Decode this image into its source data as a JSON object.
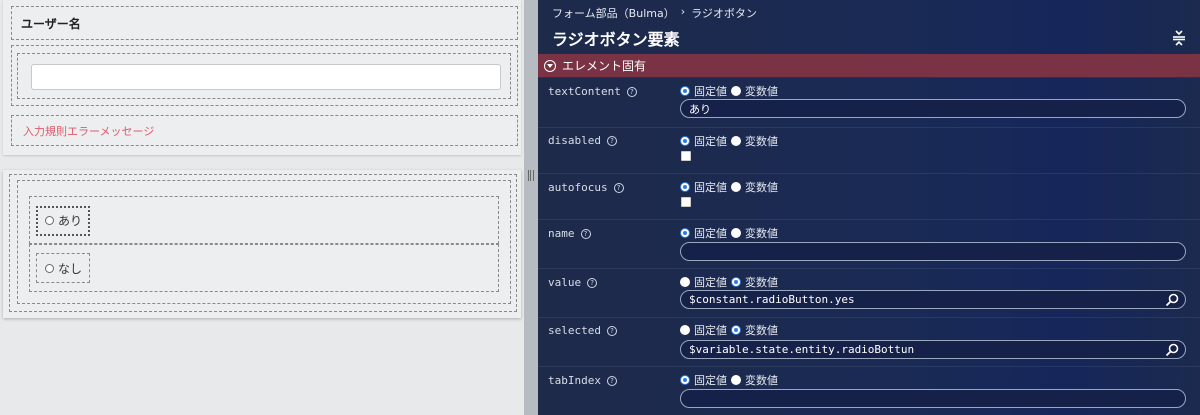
{
  "canvas": {
    "field_label": "ユーザー名",
    "error_message": "入力規則エラーメッセージ",
    "radio_options": [
      "あり",
      "なし"
    ]
  },
  "panel": {
    "breadcrumb": [
      "フォーム部品（Bulma）",
      "›",
      "ラジオボタン"
    ],
    "title": "ラジオボタン要素",
    "section_title": "エレメント固有",
    "fixed_label": "固定値",
    "variable_label": "変数値",
    "properties": [
      {
        "name": "textContent",
        "mode": "fixed",
        "value": "あり"
      },
      {
        "name": "disabled",
        "mode": "fixed",
        "checkbox": false
      },
      {
        "name": "autofocus",
        "mode": "fixed",
        "checkbox": false
      },
      {
        "name": "name",
        "mode": "fixed",
        "value": ""
      },
      {
        "name": "value",
        "mode": "variable",
        "value": "$constant.radioButton.yes"
      },
      {
        "name": "selected",
        "mode": "variable",
        "value": "$variable.state.entity.radioBottun"
      },
      {
        "name": "tabIndex",
        "mode": "fixed",
        "value": ""
      }
    ]
  },
  "colors": {
    "section_bar": "#7a3344",
    "error_text": "#e05a6b",
    "radio_selected": "#2f7be0"
  }
}
